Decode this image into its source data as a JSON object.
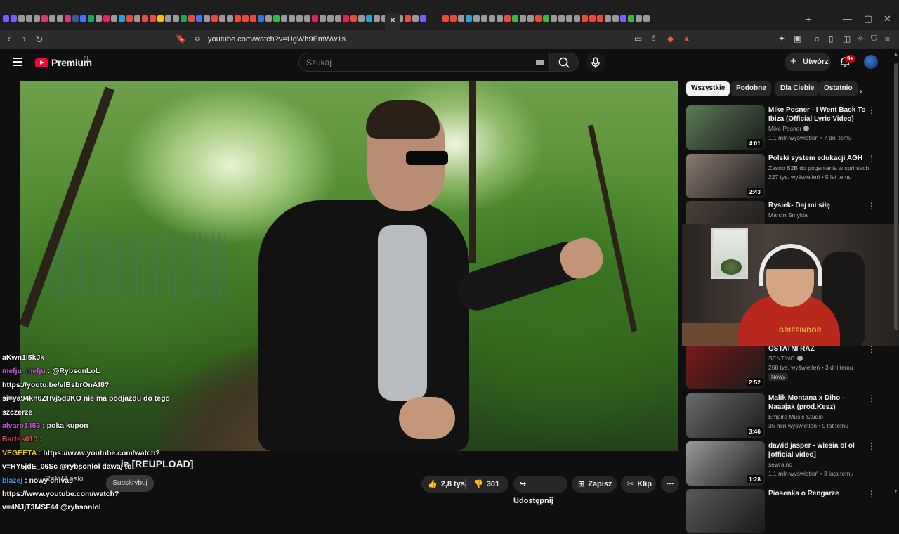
{
  "browser": {
    "url": "youtube.com/watch?v=UgWh9EmWw1s",
    "tab_colors": [
      "#7b5cff",
      "#7b5cff",
      "#9a9a9a",
      "#9a9a9a",
      "#9a9a9a",
      "#d03a7a",
      "#9a9a9a",
      "#9a9a9a",
      "#d03a7a",
      "#3b5998",
      "#4c6ef5",
      "#1ea362",
      "#9a9a9a",
      "#e0245e",
      "#9a9a9a",
      "#2ba1d8",
      "#e74c3c",
      "#9a9a9a",
      "#e74c3c",
      "#e74c3c",
      "#f1c40f",
      "#9a9a9a",
      "#9a9a9a",
      "#1ea362",
      "#e74c3c",
      "#4c6ef5",
      "#9a9a9a",
      "#e74c3c",
      "#9a9a9a",
      "#9a9a9a",
      "#e74c3c",
      "#e74c3c",
      "#e74c3c",
      "#2e7bd6",
      "#9a9a9a",
      "#3bb54a",
      "#9a9a9a",
      "#9a9a9a",
      "#9a9a9a",
      "#9a9a9a",
      "#e0245e",
      "#9a9a9a",
      "#9a9a9a",
      "#9a9a9a",
      "#e0245e",
      "#e74c3c",
      "#9a9a9a",
      "#2ba1d8",
      "#9a9a9a",
      "#9a9a9a",
      "#e74c3c",
      "#9a9a9a",
      "#e74c3c",
      "#9a9a9a",
      "#7b5cff",
      "#e74c3c",
      "#e74c3c",
      "#9a9a9a",
      "#2ba1d8",
      "#9a9a9a",
      "#9a9a9a",
      "#9a9a9a",
      "#9a9a9a",
      "#e74c3c",
      "#3bb54a",
      "#9a9a9a",
      "#9a9a9a",
      "#e74c3c",
      "#3bb54a",
      "#9a9a9a",
      "#9a9a9a",
      "#9a9a9a",
      "#9a9a9a",
      "#e74c3c",
      "#e74c3c",
      "#e74c3c",
      "#9a9a9a",
      "#9a9a9a",
      "#7b5cff",
      "#3bb54a",
      "#9a9a9a",
      "#9a9a9a"
    ]
  },
  "youtube": {
    "logo_text": "Premium",
    "logo_region": "PL",
    "search_placeholder": "Szukaj",
    "create_label": "Utwórz",
    "notif_badge": "9+"
  },
  "video": {
    "title_fragment": "ia [REUPLOAD]",
    "channel_fragment": "Rafał Łaski",
    "subscribe_label": "Subskrybuj",
    "likes": "2,8 tys.",
    "dislikes": "301",
    "share_label": "Udostępnij",
    "save_label": "Zapisz",
    "clip_label": "Klip"
  },
  "chat": [
    {
      "text": "aKwn1l5kJk",
      "color": "#ffffff"
    },
    {
      "user": "mefju_mefju",
      "user_color": "#c05cd6",
      "text": ": @RybsonLoL"
    },
    {
      "text": "https://youtu.be/vIBsbrOnAf8?",
      "color": "#ffffff"
    },
    {
      "text": "si=ya94kn6ZHvj5d9KO nie ma podjazdu do tego",
      "color": "#ffffff"
    },
    {
      "text": "szczerze",
      "color": "#ffffff"
    },
    {
      "user": "alvaro1453",
      "user_color": "#c05cd6",
      "text": ": poka kupon"
    },
    {
      "user": "Bartes610",
      "user_color": "#e74c3c",
      "text": ":"
    },
    {
      "user": "VEGEETA",
      "user_color": "#f1c40f",
      "text": ": https://www.youtube.com/watch?"
    },
    {
      "text": "v=HY5jdE_06Sc @rybsonlol dawaj to",
      "color": "#ffffff"
    },
    {
      "user": "blazej",
      "user_color": "#4a90e2",
      "text": ": nowy chivas"
    },
    {
      "text": "https://www.youtube.com/watch?",
      "color": "#ffffff"
    },
    {
      "text": "v=4NJjT3MSF44 @rybsonlol",
      "color": "#ffffff"
    }
  ],
  "chips": [
    "Wszystkie",
    "Podobne",
    "Dla Ciebie",
    "Ostatnio"
  ],
  "recommendations": [
    {
      "title": "Mike Posner - I Went Back To Ibiza (Official Lyric Video)",
      "channel": "Mike Posner",
      "verified": true,
      "stats": "1,1 mln wyświetleń • 7 dni temu",
      "duration": "4:01",
      "thumb": "#5a7a55"
    },
    {
      "title": "Polski system edukacji AGH",
      "channel": "Zasób B2B do poganiania w sprintach",
      "verified": false,
      "stats": "227 tys. wyświetleń • 5 lat temu",
      "duration": "2:43",
      "thumb": "#8a7a70"
    },
    {
      "title": "Rysiek- Daj mi siłę",
      "channel": "Marcin Smykla",
      "verified": false,
      "stats": "",
      "duration": "",
      "thumb": "#4a4038"
    },
    {
      "title": "OSTATNI RAZ",
      "channel": "SENTINO",
      "verified": true,
      "stats": "268 tys. wyświetleń • 3 dni temu",
      "duration": "2:52",
      "thumb": "#7a1a1a",
      "badge": "Nowy"
    },
    {
      "title": "Malik Montana x Diho - Naaajak (prod.Kesz)",
      "channel": "Empire Music Studio",
      "verified": false,
      "stats": "35 mln wyświetleń • 9 lat temu",
      "duration": "3:46",
      "thumb": "#6a6a6a"
    },
    {
      "title": "dawid jasper - wiesia ol ol [official video]",
      "channel": "sewraino",
      "verified": false,
      "stats": "1,1 mln wyświetleń • 3 lata temu",
      "duration": "1:28",
      "thumb": "#9a9a9a"
    },
    {
      "title": "Piosenka o Rengarze",
      "channel": "",
      "verified": false,
      "stats": "",
      "duration": "",
      "thumb": "#5a5a5a"
    }
  ],
  "facecam": {
    "shirt_text": "GRIFFINDOR"
  }
}
